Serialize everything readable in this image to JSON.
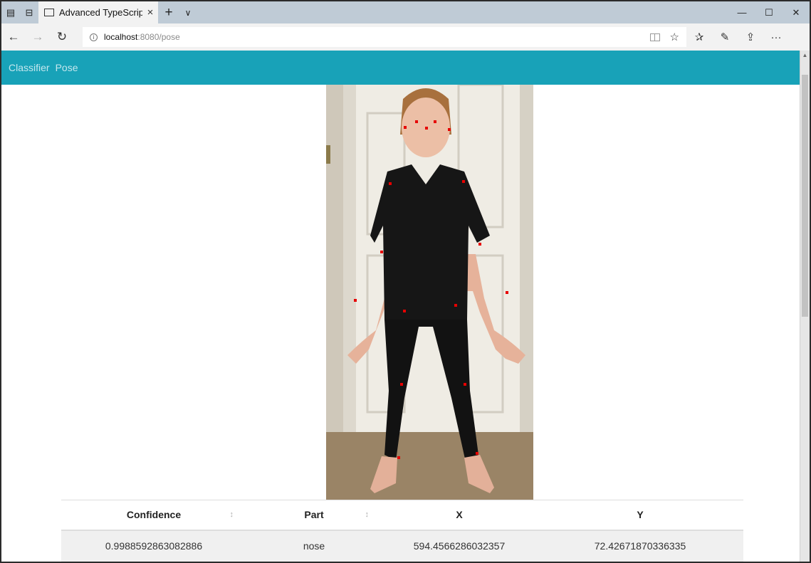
{
  "browser": {
    "tab_title": "Advanced TypeScript",
    "tab_close_glyph": "×",
    "new_tab_glyph": "+",
    "tabs_menu_glyph": "∨",
    "url_host": "localhost",
    "url_path": ":8080/pose",
    "window_controls": {
      "minimize": "—",
      "maximize": "☐",
      "close": "✕"
    },
    "nav": {
      "back": "←",
      "forward": "→",
      "refresh": "↻"
    },
    "toolbar": {
      "favorite": "☆",
      "favorites_hub": "✰",
      "notes": "✎",
      "share": "⇪",
      "more": "···"
    },
    "icons": [
      "set-aside-tabs-icon",
      "tab-preview-icon",
      "page-favicon",
      "info-icon",
      "reading-view-icon",
      "favorite-star-icon",
      "favorites-hub-icon",
      "web-notes-icon",
      "share-icon",
      "more-icon"
    ]
  },
  "app": {
    "nav_links": [
      "Classifier",
      "Pose"
    ],
    "header_color": "#18a2b8"
  },
  "keypoint_color": "#e60000",
  "table": {
    "columns": [
      {
        "label": "Confidence",
        "sortable": true
      },
      {
        "label": "Part",
        "sortable": true
      },
      {
        "label": "X",
        "sortable": false
      },
      {
        "label": "Y",
        "sortable": false
      }
    ],
    "rows": [
      [
        "0.9988592863082886",
        "nose",
        "594.4566286032357",
        "72.42671870336335"
      ]
    ]
  }
}
